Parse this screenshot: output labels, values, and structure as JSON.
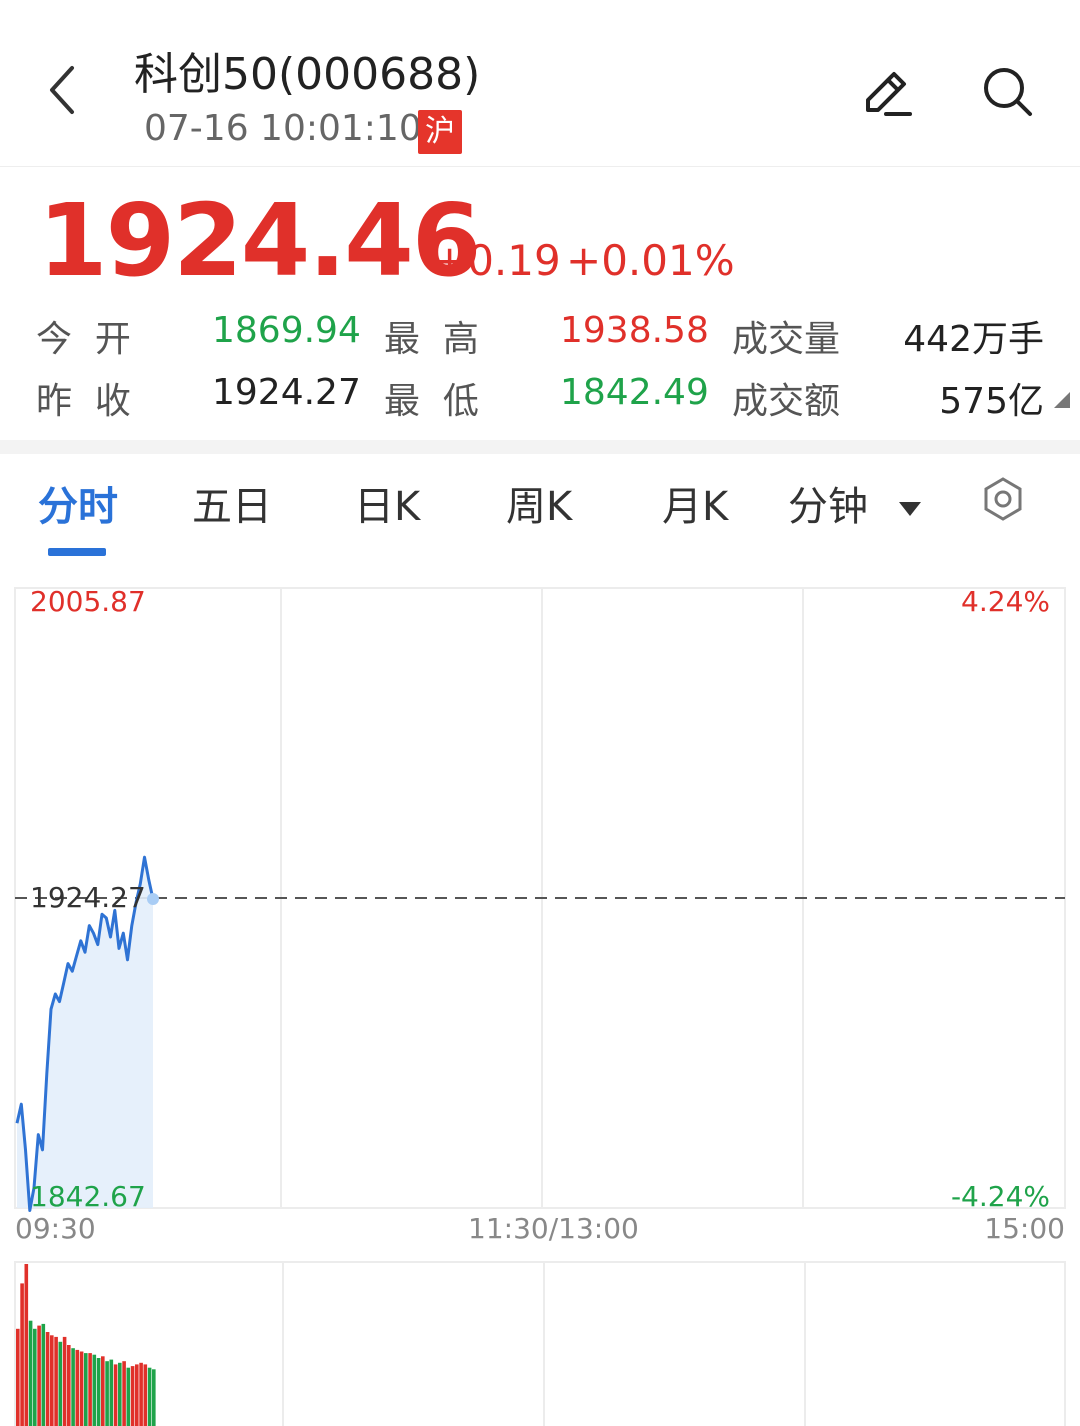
{
  "header": {
    "title": "科创50(000688)",
    "datetime": "07-16 10:01:10",
    "exchange_badge": "沪",
    "back_icon": "chevron-left-icon",
    "edit_icon": "pencil-icon",
    "search_icon": "search-icon"
  },
  "quote": {
    "price": "1924.46",
    "change": "+0.19",
    "change_pct": "+0.01%",
    "open_label": "今  开",
    "open": "1869.94",
    "prev_close_label": "昨  收",
    "prev_close": "1924.27",
    "high_label": "最  高",
    "high": "1938.58",
    "low_label": "最  低",
    "low": "1842.49",
    "volume_label": "成交量",
    "volume": "442万手",
    "amount_label": "成交额",
    "amount": "575亿"
  },
  "tabs": [
    "分时",
    "五日",
    "日K",
    "周K",
    "月K",
    "分钟"
  ],
  "settings_icon": "hexagon-settings-icon",
  "colors": {
    "up": "#e0302a",
    "down": "#1fa34a",
    "accent": "#2a72d8"
  },
  "chart_data": {
    "type": "line",
    "y_top_label": "2005.87",
    "y_bottom_label": "1842.67",
    "y_mid_label": "1924.27",
    "pct_top_label": "4.24%",
    "pct_bottom_label": "-4.24%",
    "x_labels": [
      "09:30",
      "11:30/13:00",
      "15:00"
    ],
    "ylim": [
      1842.67,
      2005.87
    ],
    "reference": 1924.27,
    "total_minutes": 240,
    "price_series": [
      1865,
      1870,
      1858,
      1842,
      1848,
      1862,
      1858,
      1878,
      1895,
      1899,
      1897,
      1902,
      1907,
      1905,
      1909,
      1913,
      1910,
      1917,
      1915,
      1912,
      1920,
      1919,
      1914,
      1921,
      1911,
      1915,
      1908,
      1917,
      1923,
      1928,
      1935,
      1929,
      1924
    ],
    "volume_max": 100,
    "volumes": [
      60,
      88,
      100,
      65,
      60,
      62,
      63,
      58,
      56,
      55,
      52,
      55,
      50,
      48,
      47,
      46,
      45,
      45,
      44,
      42,
      43,
      40,
      41,
      38,
      39,
      40,
      36,
      37,
      38,
      39,
      38,
      36,
      35
    ],
    "volume_up": [
      true,
      true,
      true,
      false,
      false,
      true,
      false,
      true,
      true,
      true,
      false,
      true,
      true,
      false,
      true,
      true,
      false,
      true,
      false,
      false,
      true,
      false,
      false,
      true,
      false,
      true,
      false,
      true,
      true,
      true,
      true,
      false,
      false
    ]
  }
}
